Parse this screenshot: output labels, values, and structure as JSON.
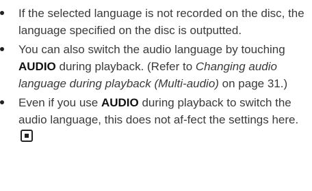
{
  "notes": [
    {
      "text": "If the selected language is not recorded on the disc, the language specified on the disc is outputted."
    },
    {
      "pre": "You can also switch the audio language by touching ",
      "bold": "AUDIO",
      "mid": " during playback. (Refer to ",
      "italic": "Changing audio language during playback (Multi-audio)",
      "post": " on page 31.)"
    },
    {
      "pre": "Even if you use ",
      "bold": "AUDIO",
      "post": " during playback to switch the audio language, this does not af-fect the settings here.",
      "end_icon": "stop-square-icon"
    }
  ]
}
